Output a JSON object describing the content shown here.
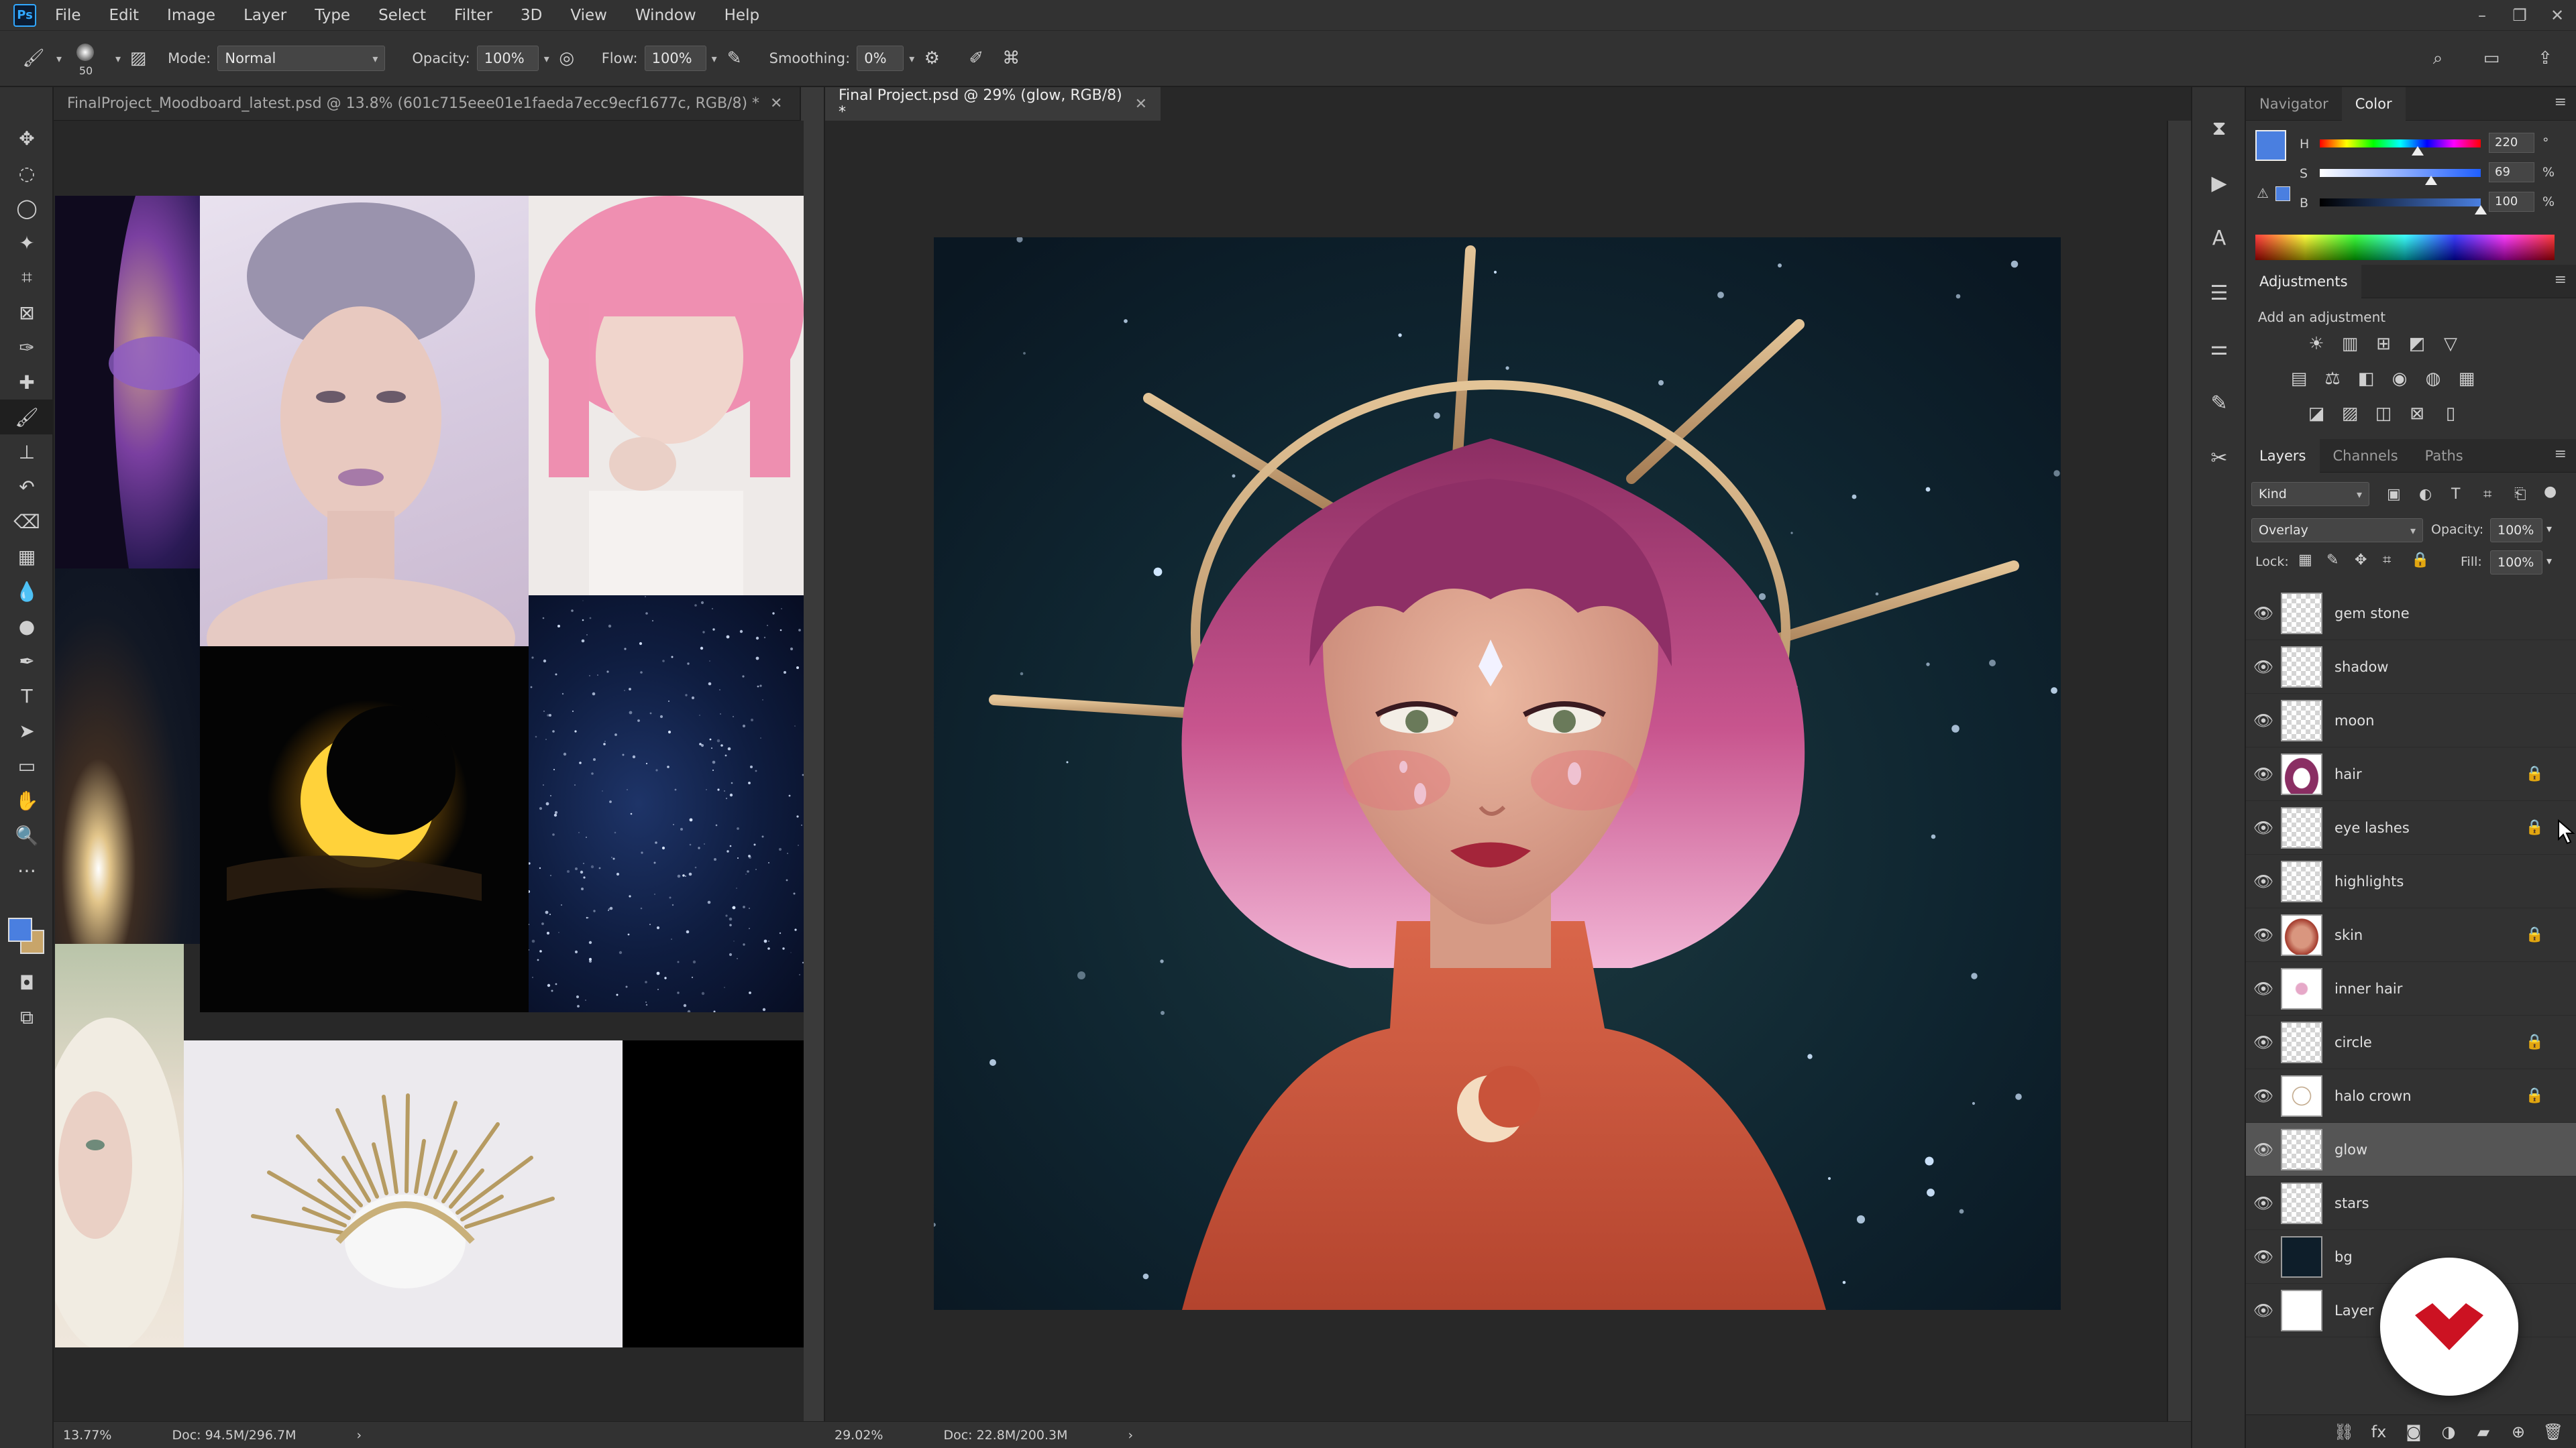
{
  "app": {
    "logo_text": "Ps",
    "menus": [
      "File",
      "Edit",
      "Image",
      "Layer",
      "Type",
      "Select",
      "Filter",
      "3D",
      "View",
      "Window",
      "Help"
    ],
    "window_controls": [
      "–",
      "❐",
      "✕"
    ]
  },
  "options": {
    "brush_size": "50",
    "mode_label": "Mode:",
    "mode_value": "Normal",
    "opacity_label": "Opacity:",
    "opacity_value": "100%",
    "flow_label": "Flow:",
    "flow_value": "100%",
    "smoothing_label": "Smoothing:",
    "smoothing_value": "0%"
  },
  "documents": [
    {
      "title": "FinalProject_Moodboard_latest.psd @ 13.8% (601c715eee01e1faeda7ecc9ecf1677c, RGB/8) *",
      "zoom": "13.77%",
      "doc_size": "Doc: 94.5M/296.7M"
    },
    {
      "title": "Final Project.psd @ 29% (glow, RGB/8) *",
      "zoom": "29.02%",
      "doc_size": "Doc: 22.8M/200.3M"
    }
  ],
  "navigator_tab": "Navigator",
  "color_panel": {
    "tab": "Color",
    "fg_color": "#4a7fe0",
    "bg_color": "#c8a56a",
    "h_label": "H",
    "h_value": "220",
    "h_unit": "°",
    "h_level": 0.61,
    "s_label": "S",
    "s_value": "69",
    "s_unit": "%",
    "s_level": 0.69,
    "b_label": "B",
    "b_value": "100",
    "b_unit": "%",
    "b_level": 1.0
  },
  "adjustments": {
    "title": "Adjustments",
    "hint": "Add an adjustment"
  },
  "layers_panel": {
    "tabs": [
      "Layers",
      "Channels",
      "Paths"
    ],
    "filter_kind": "Kind",
    "blend_mode": "Overlay",
    "opacity_label": "Opacity:",
    "opacity_value": "100%",
    "lock_label": "Lock:",
    "fill_label": "Fill:",
    "fill_value": "100%",
    "layers": [
      {
        "name": "gem stone",
        "locked": false,
        "selected": false
      },
      {
        "name": "shadow",
        "locked": false,
        "selected": false
      },
      {
        "name": "moon",
        "locked": false,
        "selected": false
      },
      {
        "name": "hair",
        "locked": true,
        "selected": false
      },
      {
        "name": "eye lashes",
        "locked": true,
        "selected": false
      },
      {
        "name": "highlights",
        "locked": false,
        "selected": false
      },
      {
        "name": "skin",
        "locked": true,
        "selected": false
      },
      {
        "name": "inner hair",
        "locked": false,
        "selected": false
      },
      {
        "name": "circle",
        "locked": true,
        "selected": false
      },
      {
        "name": "halo crown",
        "locked": true,
        "selected": false
      },
      {
        "name": "glow",
        "locked": false,
        "selected": true
      },
      {
        "name": "stars",
        "locked": false,
        "selected": false
      },
      {
        "name": "bg",
        "locked": false,
        "selected": false
      },
      {
        "name": "Layer",
        "locked": false,
        "selected": false
      }
    ]
  },
  "colors": {
    "accent_blue": "#4a7fe0",
    "brand_red": "#cc1222",
    "artwork_bg": "#0c1d2a"
  }
}
